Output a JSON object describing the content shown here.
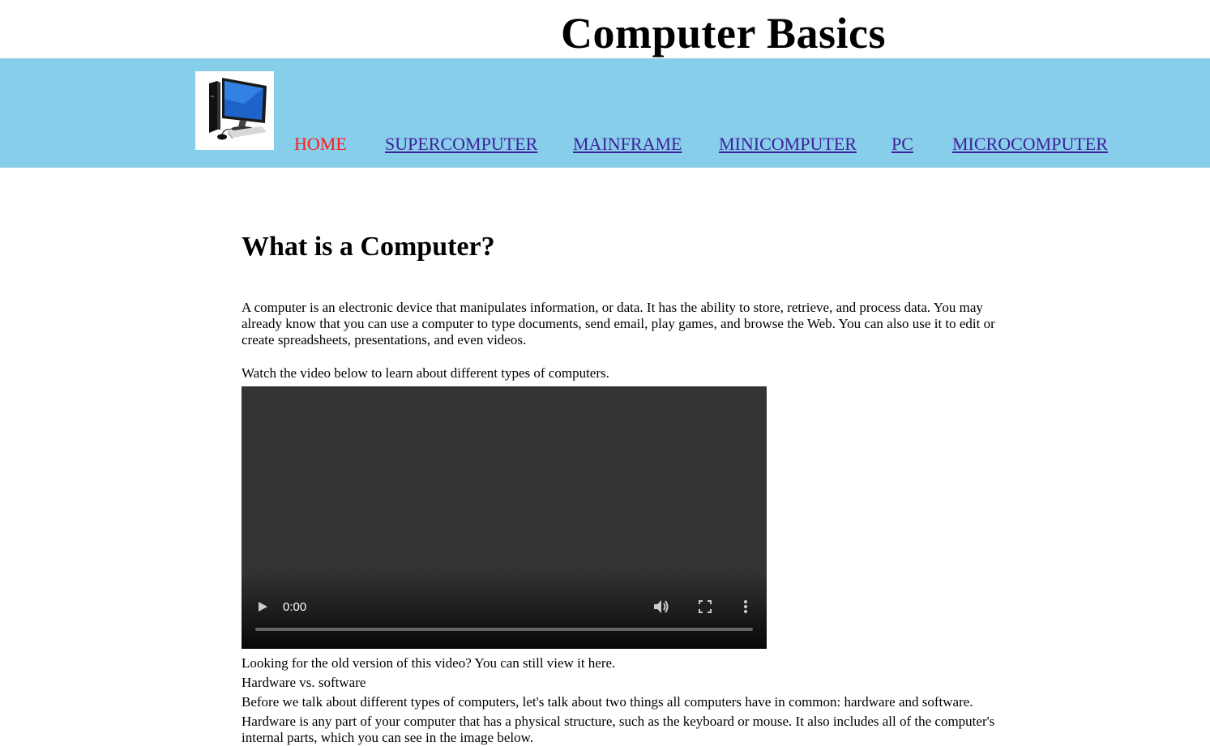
{
  "site": {
    "title": "Computer Basics"
  },
  "nav": {
    "logo_icon": "desktop-computer-icon",
    "items": [
      {
        "label": "HOME",
        "active": true
      },
      {
        "label": "SUPERCOMPUTER",
        "active": false
      },
      {
        "label": "MAINFRAME",
        "active": false
      },
      {
        "label": "MINICOMPUTER",
        "active": false
      },
      {
        "label": "PC",
        "active": false
      },
      {
        "label": "MICROCOMPUTER",
        "active": false
      }
    ]
  },
  "main": {
    "heading": "What is a Computer?",
    "intro": "A computer is an electronic device that manipulates information, or data. It has the ability to store, retrieve, and process data. You may already know that you can use a computer to type documents, send email, play games, and browse the Web. You can also use it to edit or create spreadsheets, presentations, and even videos.",
    "video_prompt": "Watch the video below to learn about different types of computers.",
    "video": {
      "time": "0:00",
      "progress": 0
    },
    "old_version": "Looking for the old version of this video? You can still view it here.",
    "hw_sw_title": "Hardware vs. software",
    "hw_sw_intro": "Before we talk about different types of computers, let's talk about two things all computers have in common: hardware and software.",
    "hardware_desc": "Hardware is any part of your computer that has a physical structure, such as the keyboard or mouse. It also includes all of the computer's internal parts, which you can see in the image below."
  },
  "colors": {
    "nav_bg": "#87ceeb",
    "link": "#40209a",
    "active_link": "#ff1a1a",
    "video_bg": "#333333"
  }
}
